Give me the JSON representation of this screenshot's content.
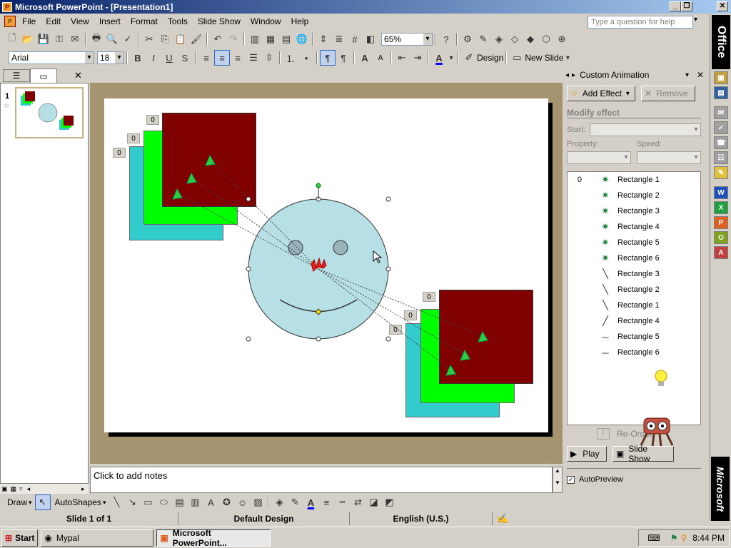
{
  "window": {
    "title": "Microsoft PowerPoint - [Presentation1]",
    "min": "_",
    "restore": "❐",
    "close": "✕"
  },
  "menu": {
    "items": [
      "File",
      "Edit",
      "View",
      "Insert",
      "Format",
      "Tools",
      "Slide Show",
      "Window",
      "Help"
    ],
    "ask_placeholder": "Type a question for help"
  },
  "toolbar": {
    "zoom": "65%",
    "font": "Arial",
    "size": "18",
    "bold": "B",
    "italic": "I",
    "underline": "U",
    "shadow": "S",
    "design": "Design",
    "new_slide": "New Slide"
  },
  "office_bar": {
    "label": "Office",
    "brand": "Microsoft"
  },
  "outline": {
    "slide_number": "1"
  },
  "slide": {
    "order_badges": [
      "0",
      "0",
      "0",
      "0",
      "0",
      "0"
    ]
  },
  "notes": {
    "placeholder": "Click to add notes"
  },
  "task_pane": {
    "title": "Custom Animation",
    "add_effect": "Add Effect",
    "remove": "Remove",
    "modify": "Modify effect",
    "start": "Start:",
    "property": "Property:",
    "speed": "Speed:",
    "reorder": "Re-Order",
    "play": "Play",
    "slide_show": "Slide Show",
    "autopreview": "AutoPreview",
    "list_number": "0",
    "items": [
      {
        "icon": "✷",
        "label": "Rectangle 1"
      },
      {
        "icon": "✷",
        "label": "Rectangle 2"
      },
      {
        "icon": "✷",
        "label": "Rectangle 3"
      },
      {
        "icon": "✷",
        "label": "Rectangle 4"
      },
      {
        "icon": "✷",
        "label": "Rectangle 5"
      },
      {
        "icon": "✷",
        "label": "Rectangle 6"
      },
      {
        "icon": "╲",
        "label": "Rectangle 3"
      },
      {
        "icon": "╲",
        "label": "Rectangle 2"
      },
      {
        "icon": "╲",
        "label": "Rectangle 1"
      },
      {
        "icon": "╱",
        "label": "Rectangle 4"
      },
      {
        "icon": "─",
        "label": "Rectangle 5"
      },
      {
        "icon": "─",
        "label": "Rectangle 6"
      }
    ]
  },
  "drawing": {
    "draw": "Draw",
    "autoshapes": "AutoShapes"
  },
  "status": {
    "slide": "Slide 1 of 1",
    "design": "Default Design",
    "language": "English (U.S.)"
  },
  "taskbar": {
    "start": "Start",
    "btn1": "Mypal",
    "btn2": "Microsoft PowerPoint...",
    "clock": "8:44 PM"
  }
}
